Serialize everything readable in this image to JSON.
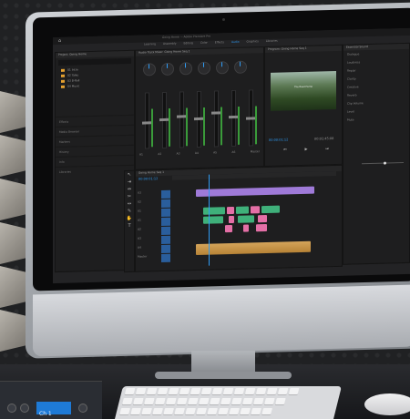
{
  "app": {
    "window_title": "Going Home — Adobe Premiere Pro"
  },
  "workspaces": [
    "Learning",
    "Assembly",
    "Editing",
    "Color",
    "Effects",
    "Audio",
    "Graphics",
    "Libraries"
  ],
  "active_workspace": "Audio",
  "project_panel": {
    "title": "Project: Going Home",
    "search_placeholder": "",
    "folders": [
      "01 Intro",
      "02 Talks",
      "03 B-Roll",
      "04 Music"
    ],
    "list_items": [
      "Effects",
      "Media Browser",
      "Markers",
      "History",
      "Info",
      "Libraries"
    ]
  },
  "mixer": {
    "title": "Audio Track Mixer: Going Home Seq 1",
    "channels": [
      "Master",
      "A1",
      "A2",
      "A3",
      "A4",
      "A5",
      "A6"
    ],
    "fader_levels": [
      0.45,
      0.5,
      0.55,
      0.5,
      0.6,
      0.52,
      0.48
    ]
  },
  "program_monitor": {
    "title": "Program: Going Home Seq 1",
    "timecode_current": "00:00:01:12",
    "timecode_total": "00:01:45:08",
    "overlay_text": "The Road Home"
  },
  "timeline": {
    "title": "Going Home Seq 1",
    "timecode": "00:00:01:12",
    "tracks": [
      "V3",
      "V2",
      "V1",
      "A1",
      "A2",
      "A3",
      "A4",
      "Master"
    ]
  },
  "essential_sound": {
    "title": "Essential Sound",
    "rows": [
      "Dialogue",
      "Loudness",
      "Repair",
      "Clarity",
      "Creative",
      "Reverb",
      "Clip Volume",
      "Level",
      "Mute"
    ]
  },
  "device": {
    "screen_text": "Ch 1"
  },
  "colors": {
    "accent": "#2f9cf5",
    "video_clip": "#9f7ad8",
    "green_clip": "#3fb07a",
    "pink_clip": "#e46fa6",
    "audio_clip": "#d4a45a"
  }
}
